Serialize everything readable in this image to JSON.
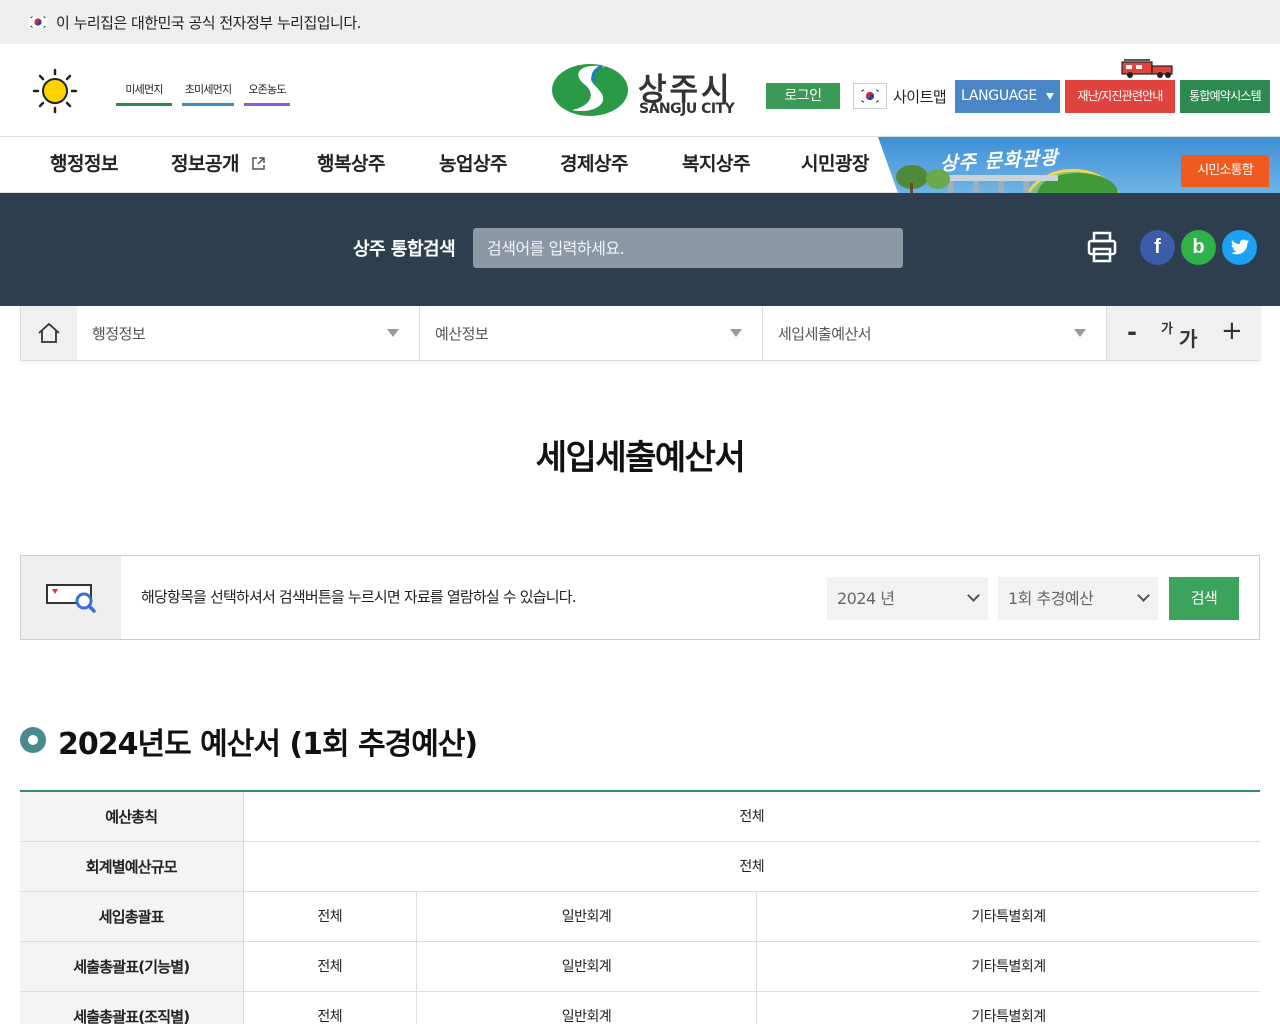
{
  "gov_banner": {
    "text": "이 누리집은 대한민국 공식 전자정부 누리집입니다."
  },
  "header": {
    "env_links": [
      "미세먼지",
      "초미세먼지",
      "오존농도"
    ],
    "logo_ko": "상주시",
    "logo_en": "SANGJU CITY",
    "login": "로그인",
    "sitemap": "사이트맵",
    "language": "LANGUAGE",
    "disaster": "재난/지진관련안내",
    "reserve": "통합예약시스템"
  },
  "nav": {
    "items": [
      "행정정보",
      "정보공개",
      "행복상주",
      "농업상주",
      "경제상주",
      "복지상주",
      "시민광장"
    ],
    "banner_text": "상주 문화관광",
    "civic_button": "시민소통함"
  },
  "search": {
    "label": "상주 통합검색",
    "placeholder": "검색어를 입력하세요."
  },
  "breadcrumb": {
    "levels": [
      "행정정보",
      "예산정보",
      "세입세출예산서"
    ],
    "font_minus": "-",
    "font_small": "가",
    "font_large": "가",
    "font_plus": "+"
  },
  "page_title": "세입세출예산서",
  "filter": {
    "instruction": "해당항목을 선택하셔서 검색버튼을 누르시면 자료를 열람하실 수 있습니다.",
    "year": "2024 년",
    "round": "1회 추경예산",
    "search_button": "검색"
  },
  "section_title": "2024년도 예산서 (1회 추경예산)",
  "table": {
    "rows": [
      {
        "header": "예산총칙",
        "cells": [
          "전체"
        ]
      },
      {
        "header": "회계별예산규모",
        "cells": [
          "전체"
        ]
      },
      {
        "header": "세입총괄표",
        "cells": [
          "전체",
          "일반회계",
          "기타특별회계"
        ]
      },
      {
        "header": "세출총괄표(기능별)",
        "cells": [
          "전체",
          "일반회계",
          "기타특별회계"
        ]
      },
      {
        "header": "세출총괄표(조직별)",
        "cells": [
          "전체",
          "일반회계",
          "기타특별회계"
        ]
      }
    ]
  },
  "colors": {
    "nav_dark": "#2e3e4e",
    "green": "#3ba45a",
    "table_top": "#2f8a7a",
    "facebook": "#3b5ca8",
    "blog": "#2db34a",
    "twitter": "#1da1f2"
  }
}
